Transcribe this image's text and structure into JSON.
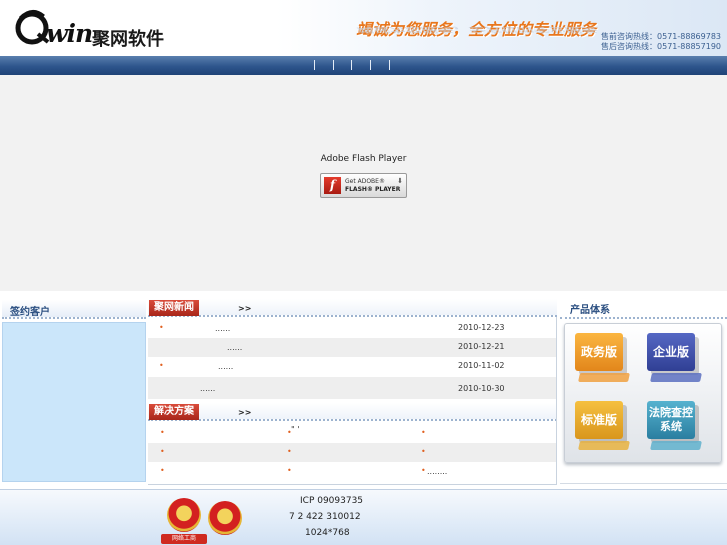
{
  "header": {
    "logo_text": "win",
    "company_name": "聚网软件",
    "slogan": "竭诚为您服务，全方位的专业服务",
    "hotlines": [
      "售前咨询热线：0571-88869783",
      "售后咨询热线：0571-88857190"
    ]
  },
  "flash": {
    "title": "Adobe Flash Player",
    "get_button_line1": "Get ADOBE®",
    "get_button_line2": "FLASH® PLAYER",
    "download_glyph": "⬇"
  },
  "clients": {
    "title": "签约客户"
  },
  "news": {
    "tab": "聚网新闻",
    "more": ">>",
    "items": [
      {
        "title": "......",
        "date": "2010-12-23"
      },
      {
        "title": "......",
        "date": "2010-12-21"
      },
      {
        "title": "......",
        "date": "2010-11-02"
      },
      {
        "title": "......",
        "date": "2010-10-30"
      }
    ]
  },
  "solutions": {
    "tab": "解决方案",
    "more": ">>",
    "rows": [
      {
        "c1": "",
        "c2": "\"  '",
        "c3": ""
      },
      {
        "c1": "",
        "c2": "",
        "c3": ""
      },
      {
        "c1": "",
        "c2": "",
        "c3": "........"
      }
    ]
  },
  "products": {
    "title": "产品体系",
    "items": [
      {
        "label": "政务版",
        "color": "#f0a02c"
      },
      {
        "label": "企业版",
        "color": "#4254ad"
      },
      {
        "label": "标准版",
        "color": "#e9ac2e"
      },
      {
        "label": "法院查控\n系统",
        "color": "#3f98b9"
      }
    ]
  },
  "footer": {
    "icp": "ICP 09093735",
    "address_line": "7 2  422     310012",
    "resolution": "1024*768",
    "badge1_label": "网络工商"
  },
  "colors": {
    "nav": "#2e558c",
    "accent_orange": "#e8761c",
    "news_tab": "#c13a2a"
  }
}
